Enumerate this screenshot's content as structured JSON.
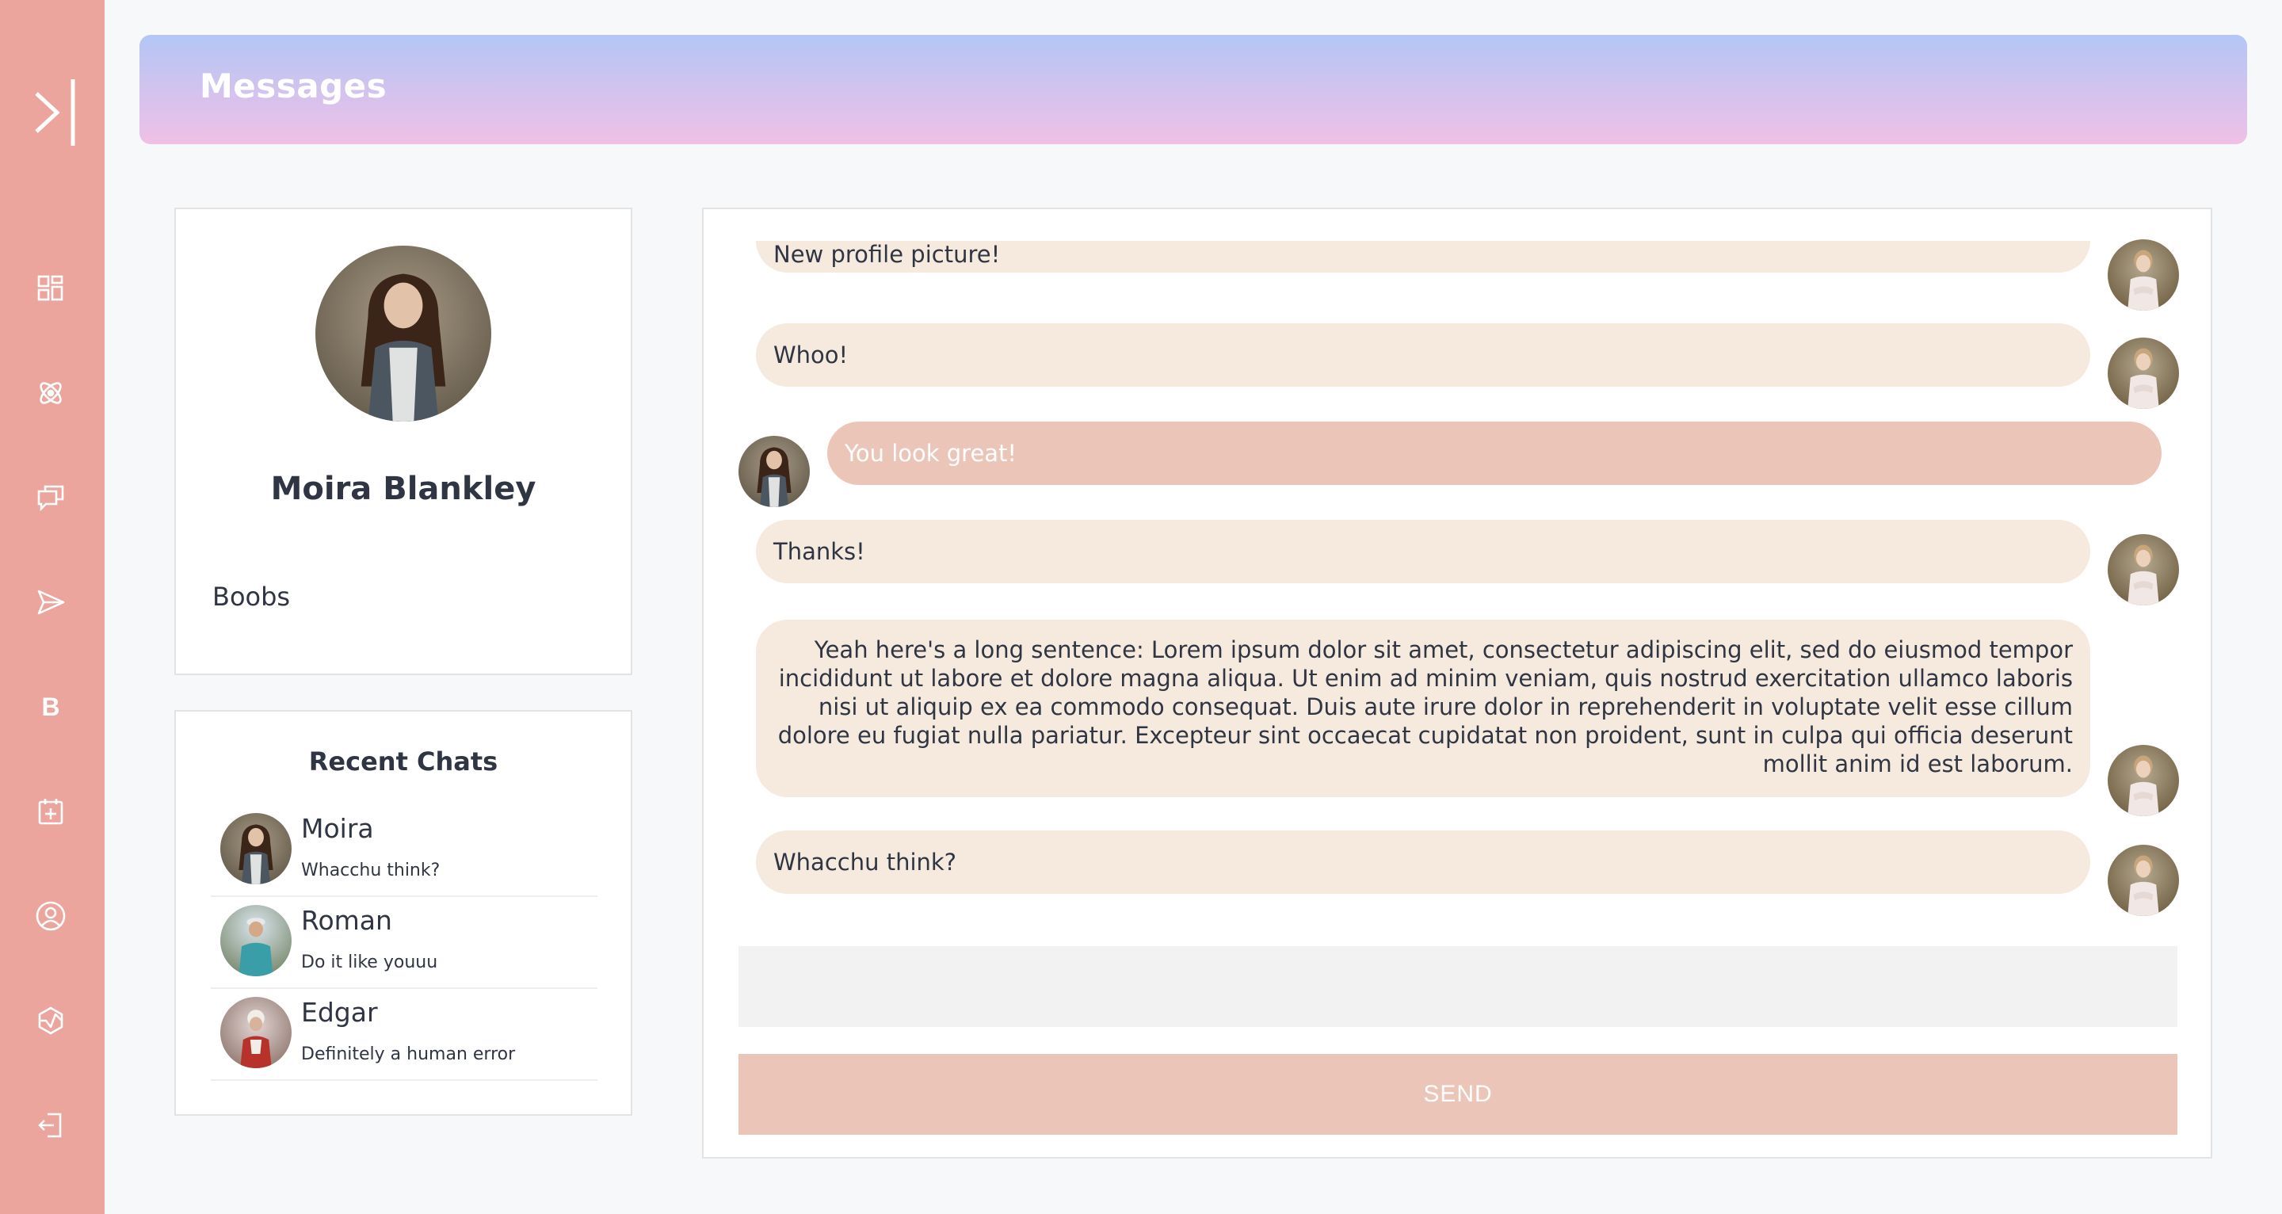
{
  "header": {
    "title": "Messages"
  },
  "sidebar": {
    "expand_icon": "sidebar-expand-icon",
    "items": [
      {
        "icon": "dashboard-icon"
      },
      {
        "icon": "atom-icon"
      },
      {
        "icon": "chat-icon"
      },
      {
        "icon": "send-icon"
      },
      {
        "icon": "bold-icon",
        "text": "B"
      },
      {
        "icon": "calendar-add-icon"
      },
      {
        "icon": "user-circle-icon"
      },
      {
        "icon": "hexagon-icon"
      },
      {
        "icon": "logout-icon"
      }
    ]
  },
  "profile": {
    "name": "Moira Blankley",
    "bio": "Boobs"
  },
  "recent_chats": {
    "title": "Recent Chats",
    "items": [
      {
        "name": "Moira",
        "preview": "Whacchu think?"
      },
      {
        "name": "Roman",
        "preview": "Do it like youuu"
      },
      {
        "name": "Edgar",
        "preview": "Definitely a human error"
      }
    ]
  },
  "messages": [
    {
      "text": "New profile picture!",
      "from": "me"
    },
    {
      "text": "Whoo!",
      "from": "me"
    },
    {
      "text": "You look great!",
      "from": "them"
    },
    {
      "text": "Thanks!",
      "from": "me"
    },
    {
      "text": "Yeah here's a long sentence: Lorem ipsum dolor sit amet, consectetur adipiscing elit, sed do eiusmod tempor incididunt ut labore et dolore magna aliqua. Ut enim ad minim veniam, quis nostrud exercitation ullamco laboris nisi ut aliquip ex ea commodo consequat. Duis aute irure dolor in reprehenderit in voluptate velit esse cillum dolore eu fugiat nulla pariatur. Excepteur sint occaecat cupidatat non proident, sunt in culpa qui officia deserunt mollit anim id est laborum.",
      "from": "me"
    },
    {
      "text": "Whacchu think?",
      "from": "me"
    }
  ],
  "composer": {
    "value": "",
    "send_label": "SEND"
  },
  "colors": {
    "sidebar": "#eba59c",
    "my_bubble": "#f6eadf",
    "their_bubble": "#ecc5b9",
    "send_button": "#ecc5b9"
  }
}
